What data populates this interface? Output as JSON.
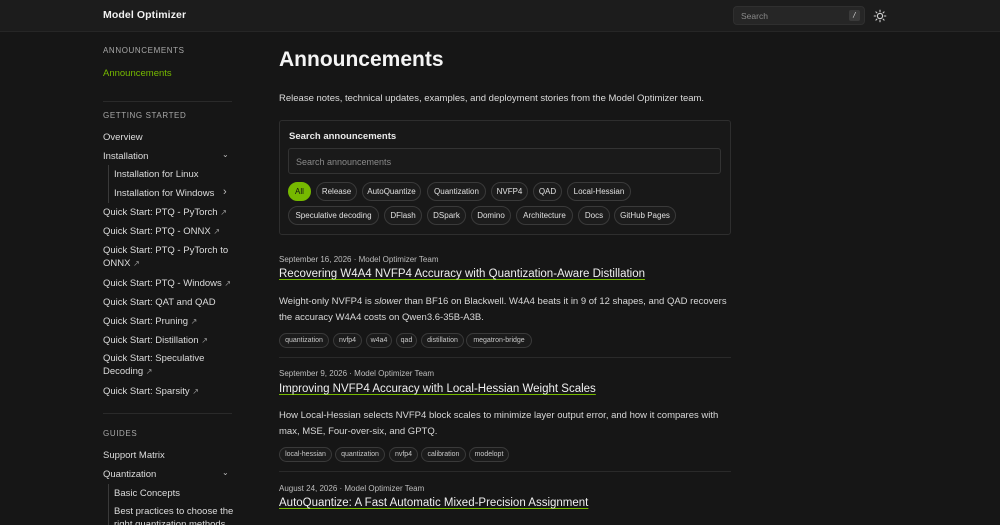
{
  "header": {
    "brand": "Model Optimizer",
    "search_placeholder": "Search",
    "search_shortcut": "/",
    "theme_icon": "theme-toggle-icon"
  },
  "sidebar": {
    "sections": [
      {
        "title": "ANNOUNCEMENTS",
        "items": [
          {
            "label": "Announcements",
            "active": true
          }
        ]
      },
      {
        "title": "GETTING STARTED",
        "items": [
          {
            "label": "Overview"
          },
          {
            "label": "Installation"
          },
          {
            "label": "Installation for Linux"
          },
          {
            "label": "Installation for Windows"
          },
          {
            "label": "Quick Start: PTQ - PyTorch"
          },
          {
            "label": "Quick Start: PTQ - ONNX"
          },
          {
            "label": "Quick Start: PTQ - PyTorch to ONNX"
          },
          {
            "label": "Quick Start: PTQ - Windows"
          },
          {
            "label": "Quick Start: QAT and QAD"
          },
          {
            "label": "Quick Start: Pruning"
          },
          {
            "label": "Quick Start: Distillation"
          },
          {
            "label": "Quick Start: Speculative Decoding"
          },
          {
            "label": "Quick Start: Sparsity"
          }
        ]
      },
      {
        "title": "GUIDES",
        "items": [
          {
            "label": "Support Matrix"
          },
          {
            "label": "Quantization"
          },
          {
            "label": "Basic Concepts"
          },
          {
            "label": "Best practices to choose the right quantization methods"
          }
        ]
      }
    ],
    "external_mark": "↗",
    "chevron_down": "⌄",
    "chevron_right": "›"
  },
  "page": {
    "title": "Announcements",
    "lead": "Release notes, technical updates, examples, and deployment stories from the Model Optimizer team."
  },
  "filter_panel": {
    "title": "Search announcements",
    "placeholder": "Search announcements",
    "chips": [
      "All",
      "Release",
      "AutoQuantize",
      "Quantization",
      "NVFP4",
      "QAD",
      "Local-Hessian",
      "Speculative decoding",
      "DFlash",
      "DSpark",
      "Domino",
      "Architecture",
      "Docs",
      "GitHub Pages"
    ],
    "active_chip": "All"
  },
  "posts": [
    {
      "meta": "September 16, 2026 · Model Optimizer Team",
      "title": "Recovering W4A4 NVFP4 Accuracy with Quantization-Aware Distillation",
      "body_pre": "Weight-only NVFP4 is ",
      "body_em": "slower",
      "body_post": " than BF16 on Blackwell. W4A4 beats it in 9 of 12 shapes, and QAD recovers the accuracy W4A4 costs on Qwen3.6-35B-A3B.",
      "tags": [
        "quantization",
        "nvfp4",
        "w4a4",
        "qad",
        "distillation",
        "megatron-bridge"
      ]
    },
    {
      "meta": "September 9, 2026 · Model Optimizer Team",
      "title": "Improving NVFP4 Accuracy with Local-Hessian Weight Scales",
      "body": "How Local-Hessian selects NVFP4 block scales to minimize layer output error, and how it compares with max, MSE, Four-over-six, and GPTQ.",
      "tags": [
        "local-hessian",
        "quantization",
        "nvfp4",
        "calibration",
        "modelopt"
      ]
    },
    {
      "meta": "August 24, 2026 · Model Optimizer Team",
      "title": "AutoQuantize: A Fast Automatic Mixed-Precision Assignment"
    }
  ]
}
